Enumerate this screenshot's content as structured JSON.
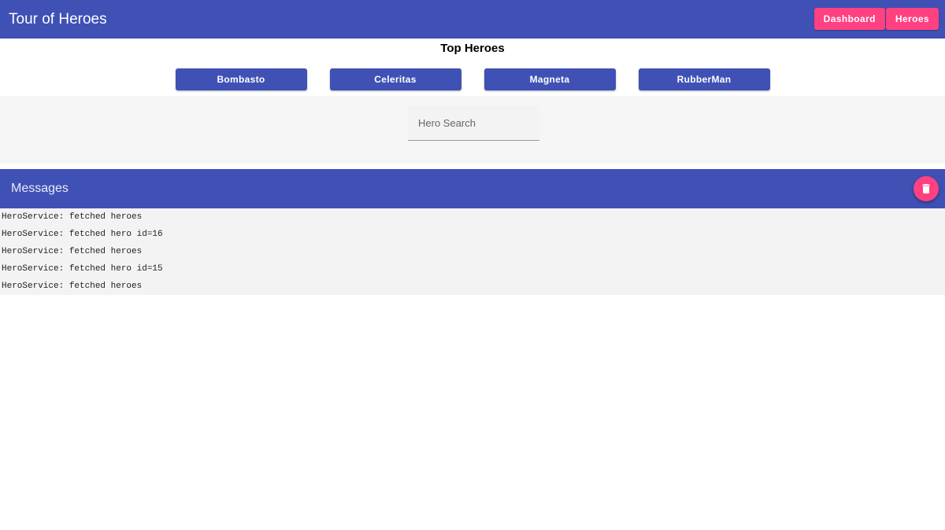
{
  "header": {
    "title": "Tour of Heroes",
    "nav": [
      {
        "label": "Dashboard"
      },
      {
        "label": "Heroes"
      }
    ]
  },
  "dashboard": {
    "heading": "Top Heroes",
    "heroes": [
      {
        "name": "Bombasto"
      },
      {
        "name": "Celeritas"
      },
      {
        "name": "Magneta"
      },
      {
        "name": "RubberMan"
      }
    ]
  },
  "search": {
    "placeholder": "Hero Search",
    "value": ""
  },
  "messages": {
    "title": "Messages",
    "clear_icon": "trash-icon",
    "items": [
      "HeroService: fetched heroes",
      "HeroService: fetched hero id=16",
      "HeroService: fetched heroes",
      "HeroService: fetched hero id=15",
      "HeroService: fetched heroes"
    ]
  },
  "colors": {
    "primary": "#3f51b5",
    "accent": "#ff4081"
  }
}
